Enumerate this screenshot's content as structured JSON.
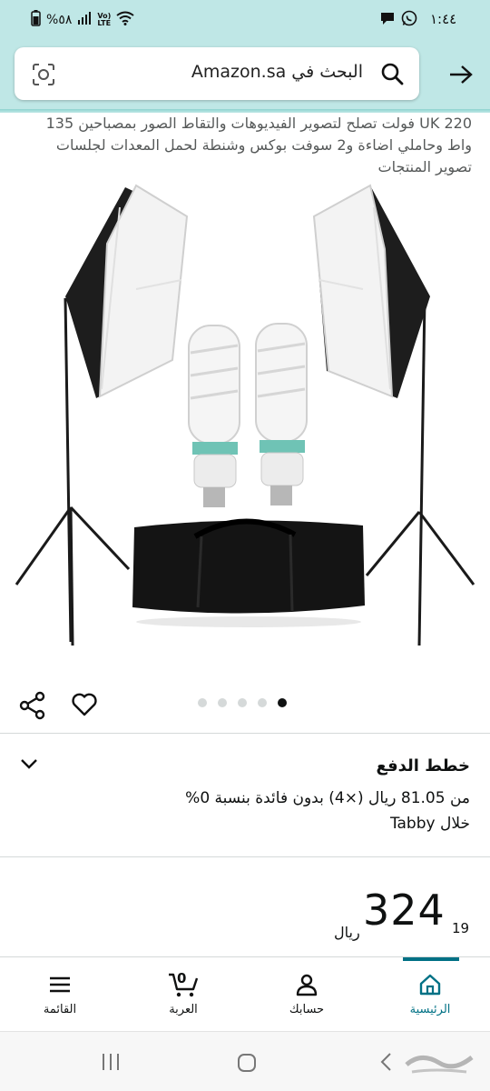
{
  "status_bar": {
    "time": "١:٤٤",
    "battery": "%٥٨"
  },
  "search": {
    "placeholder": "البحث في Amazon.sa"
  },
  "product": {
    "title": "UK 220 فولت تصلح لتصوير الفيديوهات والتقاط الصور بمصباحين 135 واط وحاملي اضاءة و2 سوفت بوكس وشنطة لحمل المعدات لجلسات تصوير المنتجات",
    "image_count": 5,
    "active_image_index": 4
  },
  "payment_plans": {
    "title": "خطط الدفع",
    "line1": "من 81.05 ريال (×4) بدون فائدة بنسبة 0%",
    "line2": "خلال Tabby"
  },
  "price": {
    "currency": "ريال",
    "whole": "324",
    "fraction": "19"
  },
  "bottom_nav": {
    "home": "الرئيسية",
    "account": "حسابك",
    "cart": "العربة",
    "cart_count": "0",
    "menu": "القائمة"
  },
  "colors": {
    "header_bg": "#bfe7e6",
    "accent": "#007185"
  }
}
